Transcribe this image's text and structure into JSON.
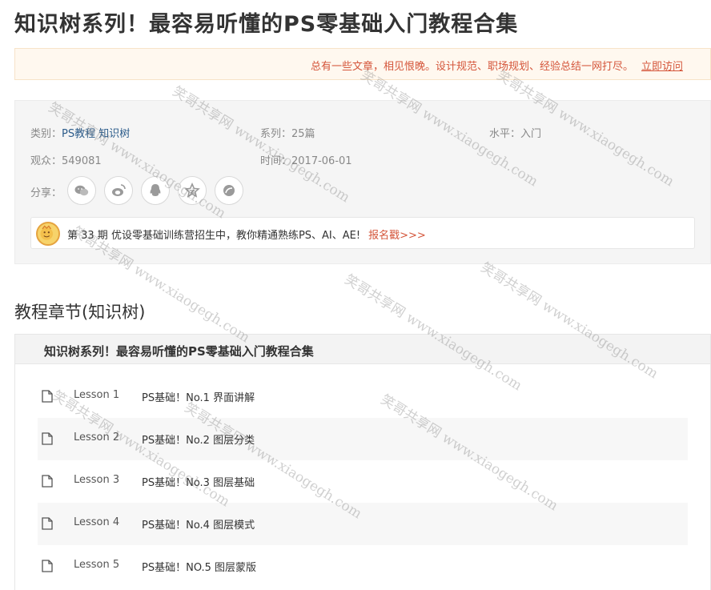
{
  "page": {
    "title": "知识树系列！最容易听懂的PS零基础入门教程合集"
  },
  "notice": {
    "text": "总有一些文章，相见恨晚。设计规范、职场规划、经验总结一网打尽。",
    "link": "立即访问"
  },
  "info": {
    "category_label": "类别：",
    "category_tags": [
      "PS教程",
      "知识树"
    ],
    "series": "系列：25篇",
    "level": "水平：入门",
    "viewers": "观众：549081",
    "time": "时间：2017-06-01",
    "share_label": "分享：",
    "share_icons": [
      "wechat-icon",
      "weibo-icon",
      "qq-icon",
      "qzone-icon",
      "more-share-icon"
    ]
  },
  "promo": {
    "text": "第 33 期 优设零基础训练营招生中，教你精通熟练PS、AI、AE!",
    "link": "报名戳>>>"
  },
  "chapters": {
    "heading": "教程章节(知识树)",
    "course_title": "知识树系列！最容易听懂的PS零基础入门教程合集",
    "lessons": [
      {
        "num": "Lesson 1",
        "title": "PS基础！No.1 界面讲解"
      },
      {
        "num": "Lesson 2",
        "title": "PS基础！No.2 图层分类"
      },
      {
        "num": "Lesson 3",
        "title": "PS基础！No.3 图层基础"
      },
      {
        "num": "Lesson 4",
        "title": "PS基础！No.4 图层模式"
      },
      {
        "num": "Lesson 5",
        "title": "PS基础！NO.5 图层蒙版"
      }
    ]
  },
  "watermark": {
    "text": "笑哥共享网 www.xiaogegh.com"
  }
}
